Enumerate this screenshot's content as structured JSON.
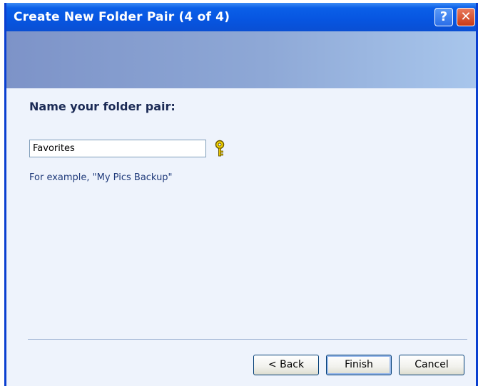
{
  "window": {
    "title": "Create New Folder Pair (4 of 4)",
    "help_button": "?",
    "close_button": "✕"
  },
  "form": {
    "heading": "Name your folder pair:",
    "folder_name_value": "Favorites",
    "example_text": "For example, \"My Pics Backup\""
  },
  "buttons": {
    "back": "< Back",
    "finish": "Finish",
    "cancel": "Cancel"
  },
  "icons": {
    "hint": "key-hint-icon"
  },
  "colors": {
    "titlebar": "#0755e0",
    "content_bg": "#eef3fc",
    "heading_text": "#1b2a55"
  }
}
